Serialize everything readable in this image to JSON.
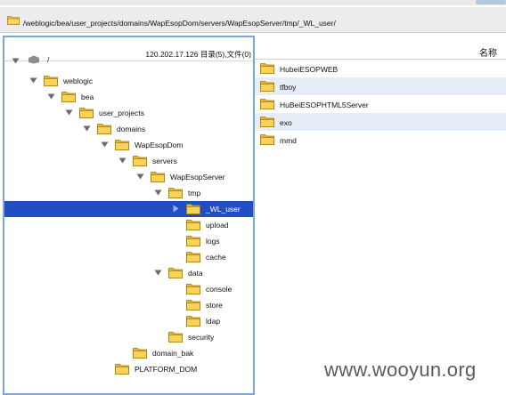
{
  "path_bar": {
    "path": "/weblogic/bea/user_projects/domains/WapEsopDom/servers/WapEsopServer/tmp/_WL_user/"
  },
  "tree_header": {
    "info": "120.202.17.126    目录(5),文件(0)"
  },
  "tree": {
    "root_label": "/",
    "items": [
      {
        "label": "weblogic",
        "expanded": true,
        "selected": false
      },
      {
        "label": "bea",
        "expanded": true,
        "selected": false
      },
      {
        "label": "user_projects",
        "expanded": true,
        "selected": false
      },
      {
        "label": "domains",
        "expanded": true,
        "selected": false
      },
      {
        "label": "WapEsopDom",
        "expanded": true,
        "selected": false
      },
      {
        "label": "servers",
        "expanded": true,
        "selected": false
      },
      {
        "label": "WapEsopServer",
        "expanded": true,
        "selected": false
      },
      {
        "label": "tmp",
        "expanded": true,
        "selected": false
      },
      {
        "label": "_WL_user",
        "expanded": false,
        "selected": true
      },
      {
        "label": "upload",
        "expanded": false,
        "selected": false
      },
      {
        "label": "logs",
        "expanded": false,
        "selected": false
      },
      {
        "label": "cache",
        "expanded": false,
        "selected": false
      },
      {
        "label": "data",
        "expanded": true,
        "selected": false
      },
      {
        "label": "console",
        "expanded": false,
        "selected": false
      },
      {
        "label": "store",
        "expanded": false,
        "selected": false
      },
      {
        "label": "ldap",
        "expanded": false,
        "selected": false
      },
      {
        "label": "security",
        "expanded": false,
        "selected": false
      },
      {
        "label": "domain_bak",
        "expanded": false,
        "selected": false
      },
      {
        "label": "PLATFORM_DOM",
        "expanded": false,
        "selected": false
      }
    ]
  },
  "file_list": {
    "column_name": "名称",
    "items": [
      {
        "name": "HubeiESOPWEB"
      },
      {
        "name": "tfboy"
      },
      {
        "name": "HuBeiESOPHTML5Server"
      },
      {
        "name": "exo"
      },
      {
        "name": "mmd"
      }
    ]
  },
  "watermark": "www.wooyun.org",
  "colors": {
    "selection": "#1f4fc2",
    "folder": "#f6c842",
    "pane_border": "#7aa6de",
    "alt_row": "#e8eef8"
  }
}
